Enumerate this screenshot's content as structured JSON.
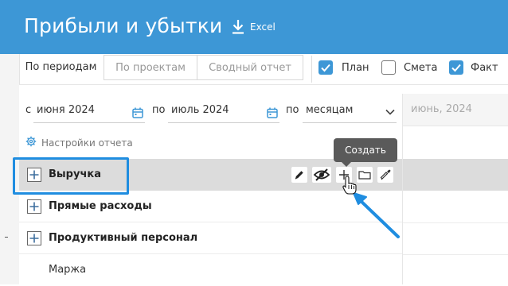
{
  "header": {
    "title": "Прибыли и убытки",
    "export_label": "Excel"
  },
  "tabs": [
    {
      "label": "По периодам",
      "active": true
    },
    {
      "label": "По проектам",
      "active": false
    },
    {
      "label": "Сводный отчет",
      "active": false
    }
  ],
  "toggles": [
    {
      "label": "План",
      "checked": true
    },
    {
      "label": "Смета",
      "checked": false
    },
    {
      "label": "Факт",
      "checked": true
    }
  ],
  "filters": {
    "from_prefix": "с",
    "from_value": "июня 2024",
    "to_prefix": "по",
    "to_value": "июль 2024",
    "group_prefix": "по",
    "group_value": "месяцам"
  },
  "settings_label": "Настройки отчета",
  "rows": [
    {
      "label": "Выручка",
      "expandable": true
    },
    {
      "label": "Прямые расходы",
      "expandable": true
    },
    {
      "label": "Продуктивный персонал",
      "expandable": true
    },
    {
      "label": "Маржа",
      "expandable": false
    }
  ],
  "column_header": "июнь, 2024",
  "tooltip": "Создать",
  "colors": {
    "header_bg": "#3d97d6",
    "accent": "#3d97d6",
    "highlight": "#1f8de0",
    "row_highlight": "#dcdcdc"
  }
}
